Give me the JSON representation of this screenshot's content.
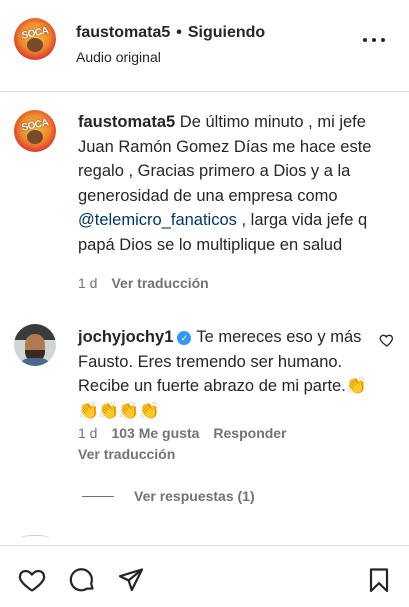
{
  "header": {
    "username": "faustomata5",
    "separator": "•",
    "follow_status": "Siguiendo",
    "subtitle": "Audio original",
    "avatar_text": "SOCA",
    "more_icon": "more-horizontal-icon"
  },
  "caption": {
    "username": "faustomata5",
    "text_before_mention": "De último minuto , mi jefe Juan Ramón Gomez Días me hace este regalo , Gracias primero a Dios y a la generosidad de una empresa como ",
    "mention": "@telemicro_fanaticos",
    "text_after_mention": " , larga vida jefe q papá Dios se lo multiplique en salud",
    "time": "1 d",
    "translate": "Ver traducción"
  },
  "comment": {
    "username": "jochyjochy1",
    "verified_icon": "verified-badge-icon",
    "verified_glyph": "✓",
    "text": "Te mereces eso y más Fausto. Eres tremendo ser humano. Recibe un fuerte abrazo de mi parte.",
    "emoji": "👏👏👏👏👏",
    "time": "1 d",
    "likes": "103 Me gusta",
    "reply": "Responder",
    "translate": "Ver traducción",
    "heart_icon": "heart-outline-icon"
  },
  "replies": {
    "label": "Ver respuestas (1)"
  },
  "bottom_bar": {
    "icons": [
      "heart-outline-icon",
      "comment-icon",
      "share-icon",
      "bookmark-icon"
    ]
  },
  "colors": {
    "text": "#262626",
    "secondary": "#737373",
    "mention": "#00376b",
    "verified": "#3897f0",
    "divider": "#dbdbdb"
  }
}
